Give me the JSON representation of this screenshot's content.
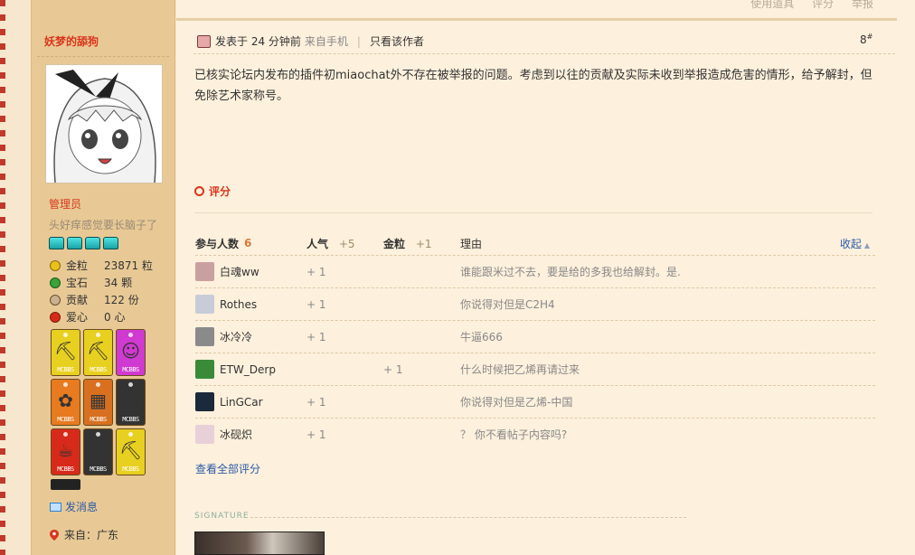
{
  "top_tools": [
    "使用道具",
    "评分",
    "举报"
  ],
  "author": {
    "name": "妖梦的舔狗",
    "role": "管理员",
    "custom_title": "头好痒感觉要长脑子了",
    "stats": [
      {
        "label": "金粒",
        "value": "23871 粒",
        "icon": "gold-coin-icon",
        "color": "#e8c21a"
      },
      {
        "label": "宝石",
        "value": "34 颗",
        "icon": "gem-icon",
        "color": "#3aa33a"
      },
      {
        "label": "贡献",
        "value": "122 份",
        "icon": "contribution-icon",
        "color": "#a88a6a"
      },
      {
        "label": "爱心",
        "value": "0 心",
        "icon": "heart-icon",
        "color": "#d82a1a"
      }
    ],
    "medals": [
      {
        "label": "MCBBS",
        "color": "#e8d020",
        "glyph": "⛏"
      },
      {
        "label": "MCBBS",
        "color": "#e8d020",
        "glyph": "⛏"
      },
      {
        "label": "MCBBS",
        "color": "#d03ad0",
        "glyph": "☺"
      },
      {
        "label": "MCBBS",
        "color": "#e87a20",
        "glyph": "✿"
      },
      {
        "label": "MCBBS",
        "color": "#d87020",
        "glyph": "▦"
      },
      {
        "label": "MCBBS",
        "color": "#333333",
        "glyph": "▩"
      },
      {
        "label": "MCBBS",
        "color": "#d82a1a",
        "glyph": "☕"
      },
      {
        "label": "MCBBS",
        "color": "#333333",
        "glyph": "☻"
      },
      {
        "label": "MCBBS",
        "color": "#e8d020",
        "glyph": "⛏"
      }
    ],
    "pm_label": "发消息",
    "from_label": "来自：广东"
  },
  "post": {
    "posted_label": "发表于 24 分钟前",
    "device_label": "来自手机",
    "author_only_label": "只看该作者",
    "floor": "8",
    "floor_suffix": "#",
    "body": "已核实论坛内发布的插件初miaochat外不存在被举报的问题。考虑到以往的贡献及实际未收到举报造成危害的情形，给予解封，但免除艺术家称号。",
    "rate_label": "评分"
  },
  "rating": {
    "participants_label": "参与人数",
    "participants_count": "6",
    "popularity_label": "人气",
    "popularity_total": "+5",
    "gold_label": "金粒",
    "gold_total": "+1",
    "reason_label": "理由",
    "collapse_label": "收起",
    "rows": [
      {
        "user": "白魂ww",
        "pop": "+ 1",
        "gold": "",
        "reason": "谁能跟米过不去，要是给的多我也给解封。是.",
        "avatar_color": "#c9a0a0"
      },
      {
        "user": "Rothes",
        "pop": "+ 1",
        "gold": "",
        "reason": "你说得对但是C2H4",
        "avatar_color": "#c8ccd8"
      },
      {
        "user": "冰冷冷",
        "pop": "+ 1",
        "gold": "",
        "reason": "牛逼666",
        "avatar_color": "#8a8a8a"
      },
      {
        "user": "ETW_Derp",
        "pop": "",
        "gold": "+ 1",
        "reason": "什么时候把乙烯再请过来",
        "avatar_color": "#3a8a3a"
      },
      {
        "user": "LinGCar",
        "pop": "+ 1",
        "gold": "",
        "reason": "你说得对但是乙烯-中国",
        "avatar_color": "#1a2a3a"
      },
      {
        "user": "冰砚炽",
        "pop": "+ 1",
        "gold": "",
        "reason": "？ 你不看帖子内容吗?",
        "avatar_color": "#e8d0d8"
      }
    ],
    "view_all_label": "查看全部评分"
  },
  "signature_label": "SIGNATURE"
}
